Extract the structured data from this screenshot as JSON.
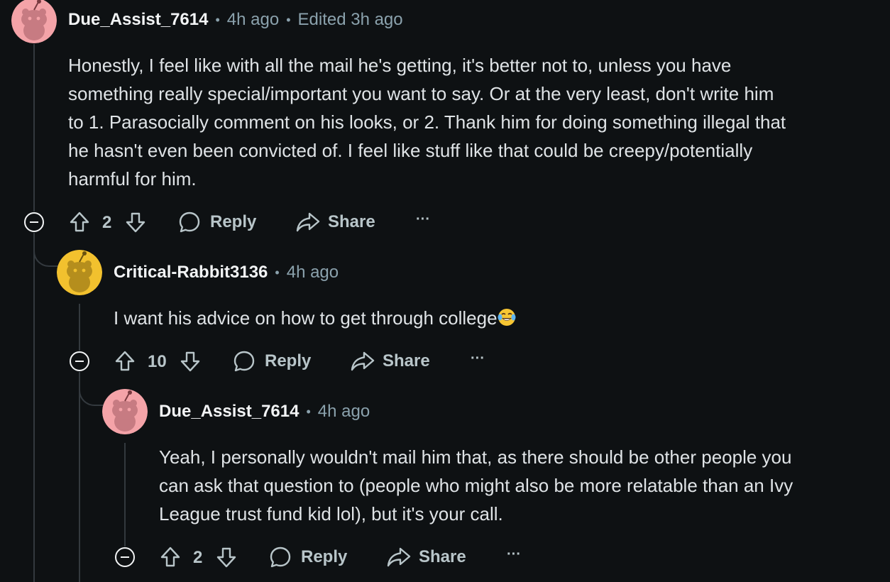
{
  "comments": [
    {
      "username": "Due_Assist_7614",
      "time": "4h ago",
      "edited": "Edited 3h ago",
      "avatar_color": "#f4a3a8",
      "body_lines": [
        "Honestly, I feel like with all the mail he's getting, it's better not to, unless you have",
        "something really special/important you want to say. Or at the very least, don't write him",
        "to 1. Parasocially comment on his looks, or 2. Thank him for doing something illegal that",
        "he hasn't even been convicted of. I feel like stuff like that could be creepy/potentially",
        "harmful for him."
      ],
      "score": "2",
      "reply_label": "Reply",
      "share_label": "Share",
      "more_label": "···"
    },
    {
      "username": "Critical-Rabbit3136",
      "time": "4h ago",
      "avatar_color": "#f2c12e",
      "body_text": "I want his advice on how to get through college",
      "emoji": "face-with-tears-of-joy-icon",
      "score": "10",
      "reply_label": "Reply",
      "share_label": "Share",
      "more_label": "···"
    },
    {
      "username": "Due_Assist_7614",
      "time": "4h ago",
      "avatar_color": "#f4a3a8",
      "body_lines": [
        "Yeah, I personally wouldn't mail him that, as there should be other people you",
        "can ask that question to (people who might also be more relatable than an Ivy",
        "League trust fund kid lol), but it's your call."
      ],
      "score": "2",
      "reply_label": "Reply",
      "share_label": "Share",
      "more_label": "···"
    }
  ],
  "colors": {
    "background": "#0e1113",
    "text": "#dfe3e6",
    "meta": "#8ba2ad",
    "thread_line": "#33393e",
    "action": "#b8c5c9"
  }
}
